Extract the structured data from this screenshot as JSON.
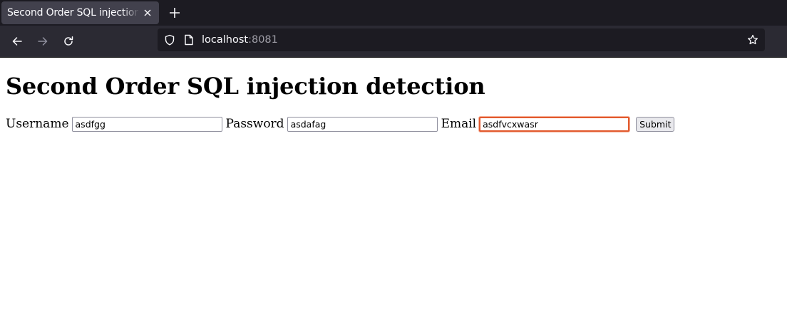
{
  "browser": {
    "tab_title": "Second Order SQL injection detection",
    "url_host": "localhost",
    "url_port": ":8081"
  },
  "page": {
    "heading": "Second Order SQL injection detection",
    "form": {
      "username_label": "Username",
      "username_value": "asdfgg",
      "password_label": "Password",
      "password_value": "asdafag",
      "email_label": "Email",
      "email_value": "asdfvcxwasr",
      "submit_label": "Submit"
    }
  },
  "colors": {
    "tabbar_bg": "#1c1b22",
    "active_tab_bg": "#42414d",
    "navbar_bg": "#2b2a33",
    "focus_ring": "#e25a2e"
  }
}
